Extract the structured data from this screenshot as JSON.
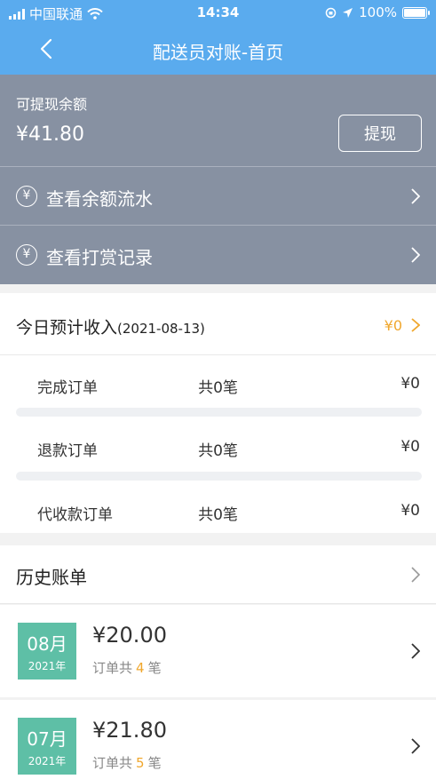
{
  "status_bar": {
    "carrier": "中国联通",
    "time": "14:34",
    "battery": "100%",
    "battery_level": 1.0
  },
  "nav": {
    "title": "配送员对账-首页",
    "back_icon": "chevron-left-icon"
  },
  "balance": {
    "label": "可提现余额",
    "amount": "¥41.80",
    "withdraw_label": "提现",
    "rows": [
      {
        "icon": "yen-circle-icon",
        "label": "查看余额流水"
      },
      {
        "icon": "yen-circle-icon",
        "label": "查看打赏记录"
      }
    ]
  },
  "today": {
    "title": "今日预计收入",
    "date": "(2021-08-13)",
    "total": "¥0",
    "rows": [
      {
        "name": "完成订单",
        "count": "共0笔",
        "amount": "¥0"
      },
      {
        "name": "退款订单",
        "count": "共0笔",
        "amount": "¥0"
      },
      {
        "name": "代收款订单",
        "count": "共0笔",
        "amount": "¥0"
      }
    ]
  },
  "history": {
    "title": "历史账单",
    "bills": [
      {
        "month": "08月",
        "year": "2021年",
        "amount": "¥20.00",
        "count_prefix": "订单共",
        "count": "4",
        "count_suffix": "笔"
      },
      {
        "month": "07月",
        "year": "2021年",
        "amount": "¥21.80",
        "count_prefix": "订单共",
        "count": "5",
        "count_suffix": "笔"
      }
    ]
  },
  "colors": {
    "nav": "#5aabee",
    "balance_card": "#8791a2",
    "accent": "#f0a72d",
    "badge": "#5ebfa6"
  }
}
